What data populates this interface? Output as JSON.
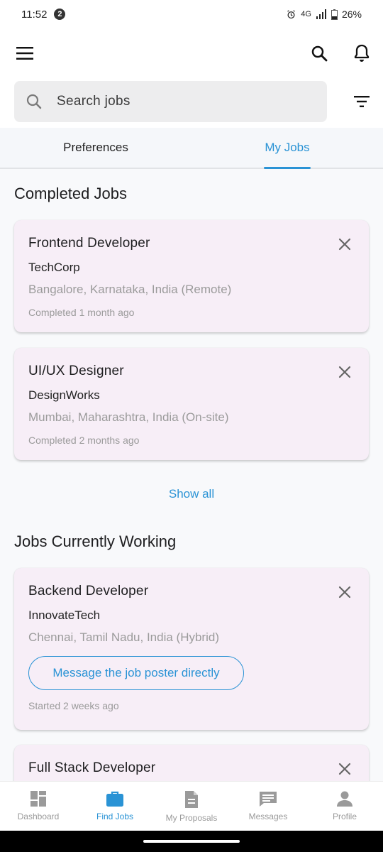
{
  "status_bar": {
    "time": "11:52",
    "notification_count": "2",
    "network": "4G",
    "battery": "26%"
  },
  "search": {
    "placeholder": "Search jobs"
  },
  "tabs": [
    {
      "label": "Preferences"
    },
    {
      "label": "My Jobs",
      "active": true
    }
  ],
  "sections": {
    "completed": {
      "title": "Completed Jobs",
      "show_all": "Show all",
      "jobs": [
        {
          "title": "Frontend Developer",
          "company": "TechCorp",
          "location": "Bangalore, Karnataka, India (Remote)",
          "status": "Completed 1 month ago"
        },
        {
          "title": "UI/UX Designer",
          "company": "DesignWorks",
          "location": "Mumbai, Maharashtra, India (On-site)",
          "status": "Completed 2 months ago"
        }
      ]
    },
    "working": {
      "title": "Jobs Currently Working",
      "jobs": [
        {
          "title": "Backend Developer",
          "company": "InnovateTech",
          "location": "Chennai, Tamil Nadu, India (Hybrid)",
          "message_button": "Message the job poster directly",
          "status": "Started 2 weeks ago"
        },
        {
          "title": "Full Stack Developer"
        }
      ]
    }
  },
  "bottom_nav": [
    {
      "label": "Dashboard",
      "icon": "dashboard-icon"
    },
    {
      "label": "Find Jobs",
      "icon": "briefcase-icon",
      "active": true
    },
    {
      "label": "My Proposals",
      "icon": "document-icon"
    },
    {
      "label": "Messages",
      "icon": "message-icon"
    },
    {
      "label": "Profile",
      "icon": "person-icon"
    }
  ],
  "colors": {
    "accent": "#2a93d5",
    "card_bg": "#f7eef7",
    "muted_text": "#9b9b9b"
  }
}
